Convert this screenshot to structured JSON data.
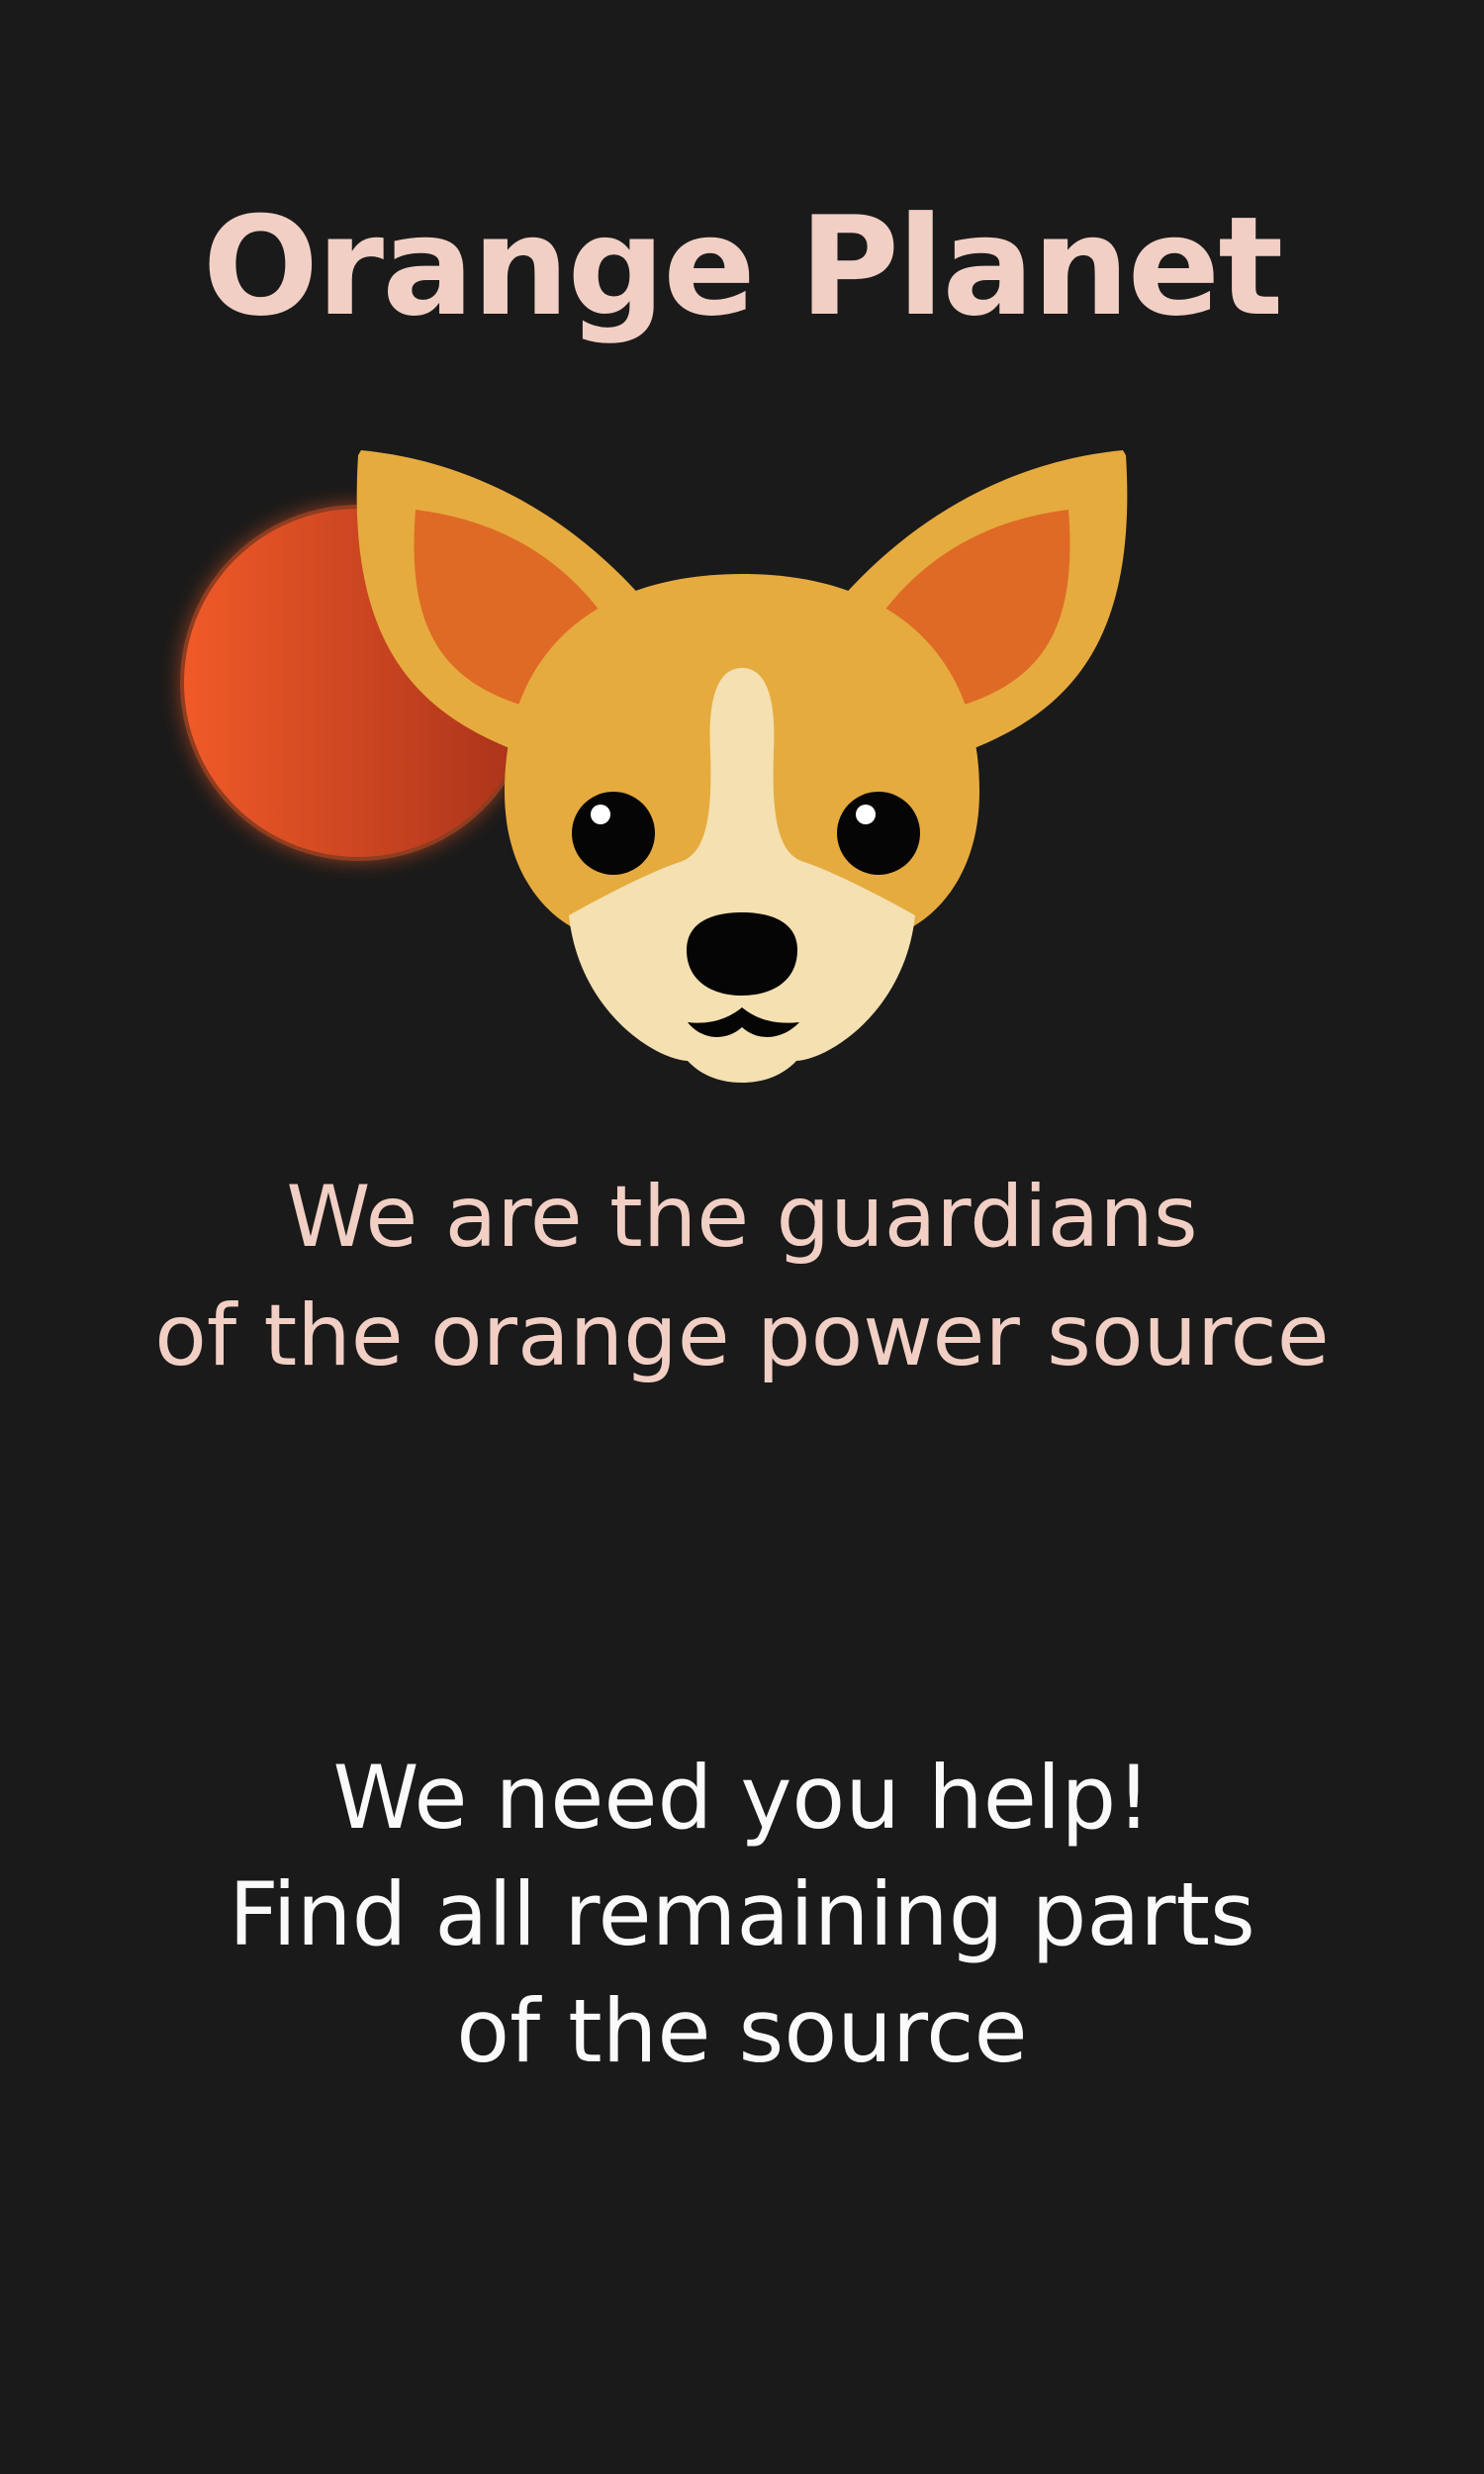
{
  "title": "Orange Planet",
  "tagline": {
    "line1": "We are the guardians",
    "line2": "of the orange power source"
  },
  "call_to_action": {
    "line1": "We need you help!",
    "line2": "Find all remaining parts",
    "line3": "of the source"
  },
  "icons": {
    "planet": "orange-planet-icon",
    "mascot": "chihuahua-face-icon"
  },
  "colors": {
    "background": "#1a1a1a",
    "title": "#f2cfc4",
    "body_text": "#fafafa",
    "planet_light": "#f05a28",
    "planet_dark": "#a8321a",
    "dog_fur": "#e6ab3e",
    "dog_inner_ear": "#de6a25",
    "dog_muzzle": "#f4e0b0"
  }
}
